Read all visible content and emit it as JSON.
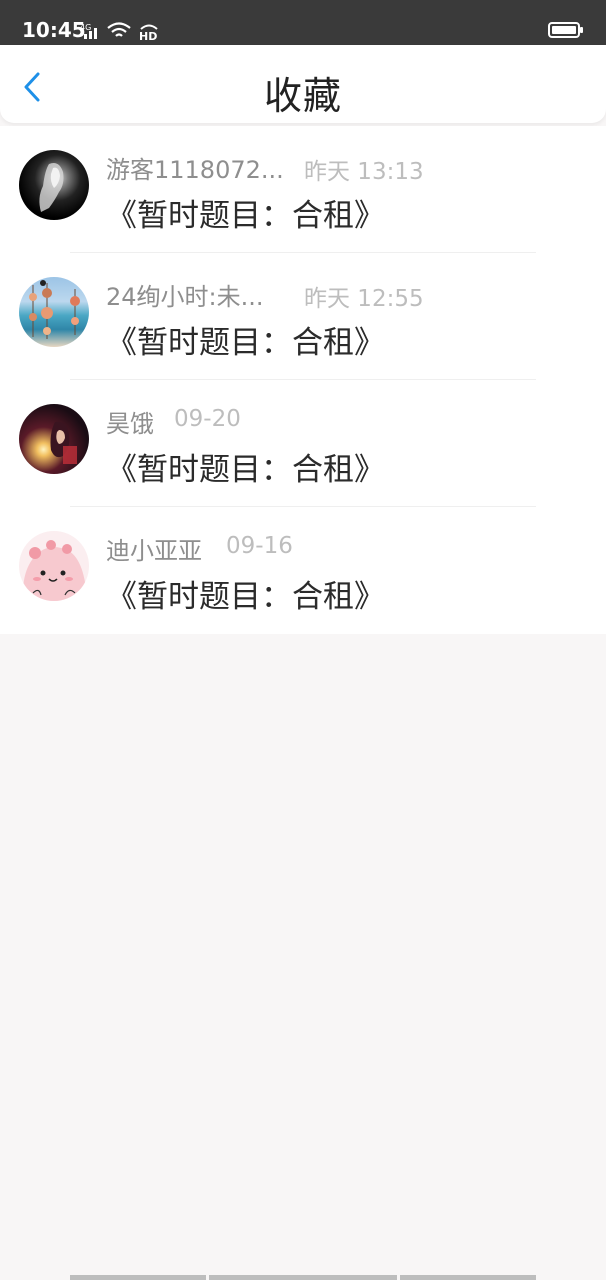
{
  "status": {
    "time": "10:45",
    "network": "4G",
    "hd": "HD"
  },
  "header": {
    "title": "收藏"
  },
  "items": [
    {
      "name": "游客1118072...",
      "time": "昨天 13:13",
      "title": "《暂时题目：合租》"
    },
    {
      "name": "24绚小时:未...",
      "time": "昨天 12:55",
      "title": "《暂时题目：合租》"
    },
    {
      "name": "昊饿",
      "time": "09-20",
      "title": "《暂时题目：合租》"
    },
    {
      "name": "迪小亚亚",
      "time": "09-16",
      "title": "《暂时题目：合租》"
    }
  ],
  "colors": {
    "accent": "#1e90e8",
    "statusBar": "#3a3a3a",
    "background": "#f8f6f6"
  }
}
